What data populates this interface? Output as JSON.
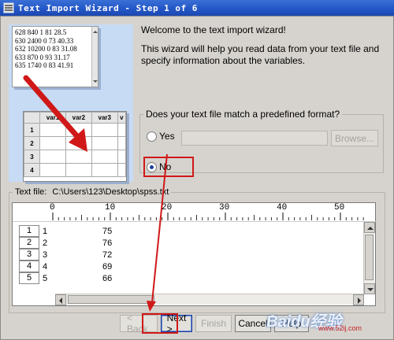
{
  "window": {
    "title": "Text Import Wizard - Step 1 of 6"
  },
  "illustration": {
    "notepad_lines": [
      "628 840 1 81 28.5",
      "630 2400 0 73 40.33",
      "632 10200 0 83 31.08",
      "633 870 0 93 31.17",
      "635 1740 0 83 41.91"
    ],
    "grid_headers": [
      "var1",
      "var2",
      "var3",
      "v"
    ],
    "grid_rows": [
      "1",
      "2",
      "3",
      "4"
    ]
  },
  "intro": {
    "welcome": "Welcome to the text import wizard!",
    "description": "This wizard will help you read data from your text file and specify information about the variables."
  },
  "format_group": {
    "legend": "Does your text file match a predefined format?",
    "yes_label": "Yes",
    "no_label": "No",
    "selected": "No",
    "browse_label": "Browse..."
  },
  "text_file": {
    "label": "Text file:",
    "path": "C:\\Users\\123\\Desktop\\spss.txt",
    "ruler_marks": [
      "0",
      "10",
      "20",
      "30",
      "40",
      "50"
    ],
    "rows": [
      {
        "num": "1",
        "c1": "1",
        "c2": "75"
      },
      {
        "num": "2",
        "c1": "2",
        "c2": "76"
      },
      {
        "num": "3",
        "c1": "3",
        "c2": "72"
      },
      {
        "num": "4",
        "c1": "4",
        "c2": "69"
      },
      {
        "num": "5",
        "c1": "5",
        "c2": "66"
      }
    ]
  },
  "buttons": {
    "back": "< Back",
    "next": "Next >",
    "finish": "Finish",
    "cancel": "Cancel",
    "help": "Help"
  },
  "watermark": {
    "text": "Baidu经验",
    "site": "www.52ij.com"
  },
  "colors": {
    "titlebar": "#2457c7",
    "highlight": "#d01818",
    "illustration_bg": "#c7dbf5"
  }
}
